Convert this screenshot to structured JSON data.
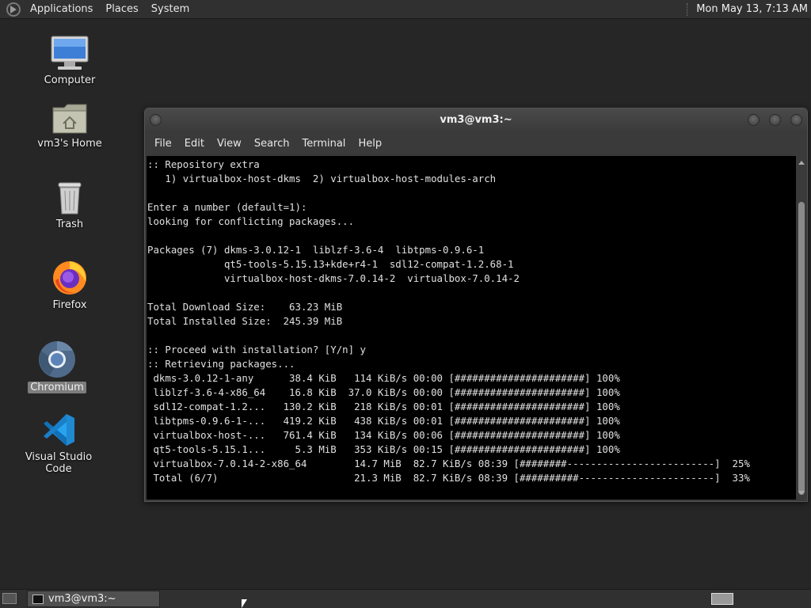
{
  "top_panel": {
    "menus": [
      "Applications",
      "Places",
      "System"
    ],
    "clock": "Mon May 13,  7:13 AM"
  },
  "desktop_icons": [
    {
      "label": "Computer",
      "icon": "computer-icon"
    },
    {
      "label": "vm3's Home",
      "icon": "home-folder-icon"
    },
    {
      "label": "Trash",
      "icon": "trash-icon"
    },
    {
      "label": "Firefox",
      "icon": "firefox-icon"
    },
    {
      "label": "Chromium",
      "icon": "chromium-icon",
      "selected": true
    },
    {
      "label": "Visual Studio Code",
      "icon": "vscode-icon"
    }
  ],
  "terminal": {
    "title": "vm3@vm3:~",
    "menu": [
      "File",
      "Edit",
      "View",
      "Search",
      "Terminal",
      "Help"
    ],
    "lines": [
      ":: Repository extra",
      "   1) virtualbox-host-dkms  2) virtualbox-host-modules-arch",
      "",
      "Enter a number (default=1):",
      "looking for conflicting packages...",
      "",
      "Packages (7) dkms-3.0.12-1  liblzf-3.6-4  libtpms-0.9.6-1",
      "             qt5-tools-5.15.13+kde+r4-1  sdl12-compat-1.2.68-1",
      "             virtualbox-host-dkms-7.0.14-2  virtualbox-7.0.14-2",
      "",
      "Total Download Size:    63.23 MiB",
      "Total Installed Size:  245.39 MiB",
      "",
      ":: Proceed with installation? [Y/n] y",
      ":: Retrieving packages...",
      " dkms-3.0.12-1-any      38.4 KiB   114 KiB/s 00:00 [######################] 100%",
      " liblzf-3.6-4-x86_64    16.8 KiB  37.0 KiB/s 00:00 [######################] 100%",
      " sdl12-compat-1.2...   130.2 KiB   218 KiB/s 00:01 [######################] 100%",
      " libtpms-0.9.6-1-...   419.2 KiB   438 KiB/s 00:01 [######################] 100%",
      " virtualbox-host-...   761.4 KiB   134 KiB/s 00:06 [######################] 100%",
      " qt5-tools-5.15.1...     5.3 MiB   353 KiB/s 00:15 [######################] 100%",
      " virtualbox-7.0.14-2-x86_64        14.7 MiB  82.7 KiB/s 08:39 [########-------------------------]  25%",
      " Total (6/7)                       21.3 MiB  82.7 KiB/s 08:39 [##########-----------------------]  33%"
    ]
  },
  "taskbar": {
    "task_label": "vm3@vm3:~"
  }
}
